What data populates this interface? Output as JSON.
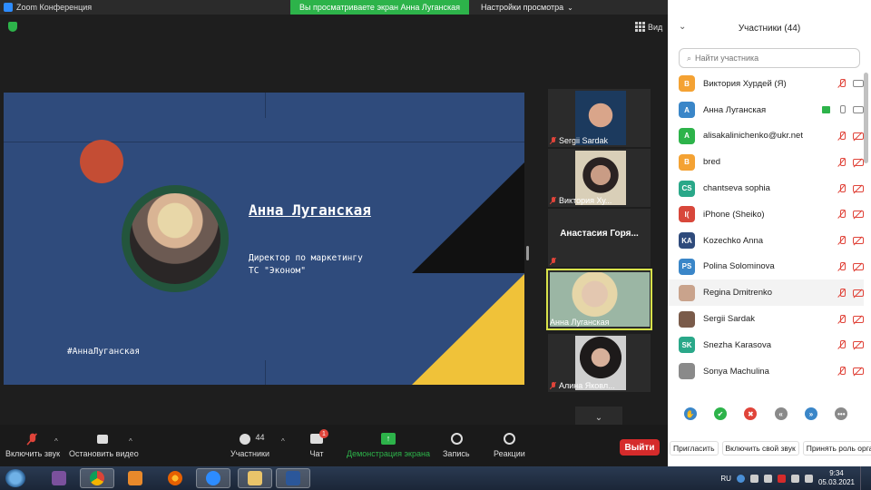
{
  "window": {
    "title": "Zoom Конференция"
  },
  "share_banner": "Вы просматриваете экран Анна Луганская",
  "view_settings": "Настройки просмотра",
  "view_button": "Вид",
  "slide": {
    "name": "Анна Луганская",
    "role_line1": "Директор по маркетингу",
    "role_line2": "ТС \"Эконом\"",
    "hashtag": "#АннаЛуганская"
  },
  "thumbnails": [
    {
      "label": "Sergii Sardak"
    },
    {
      "label": "Виктория  Ху..."
    },
    {
      "label": "Анастасия Горя...",
      "center": true
    },
    {
      "label": "Анна Луганская",
      "active": true
    },
    {
      "label": "Алина Яковл..."
    }
  ],
  "toolbar": {
    "unmute": "Включить звук",
    "start_video": "Остановить видео",
    "participants": "Участники",
    "participants_count": "44",
    "chat": "Чат",
    "chat_badge": "1",
    "share": "Демонстрация экрана",
    "record": "Запись",
    "reactions": "Реакции",
    "leave": "Выйти"
  },
  "panel": {
    "title": "Участники (44)",
    "search_placeholder": "Найти участника",
    "participants": [
      {
        "initials": "В",
        "name": "Виктория  Хурдей (Я)",
        "color": "#f4a233",
        "share": false,
        "mic": "off",
        "cam": "on"
      },
      {
        "initials": "А",
        "name": "Анна Луганская",
        "color": "#3a86c8",
        "share": true,
        "mic": "on",
        "cam": "on"
      },
      {
        "initials": "A",
        "name": "alisakalinichenko@ukr.net",
        "color": "#2db34a",
        "share": false,
        "mic": "off",
        "cam": "off"
      },
      {
        "initials": "B",
        "name": "bred",
        "color": "#f4a233",
        "share": false,
        "mic": "off",
        "cam": "off"
      },
      {
        "initials": "CS",
        "name": "chantseva sophia",
        "color": "#2aa889",
        "share": false,
        "mic": "off",
        "cam": "off"
      },
      {
        "initials": "I(",
        "name": "iPhone (Sheiko)",
        "color": "#d8473b",
        "share": false,
        "mic": "off",
        "cam": "off"
      },
      {
        "initials": "KA",
        "name": "Kozechko Anna",
        "color": "#2f4b7c",
        "share": false,
        "mic": "off",
        "cam": "off"
      },
      {
        "initials": "PS",
        "name": "Polina Solominova",
        "color": "#3a86c8",
        "share": false,
        "mic": "off",
        "cam": "off"
      },
      {
        "initials": "",
        "name": "Regina Dmitrenko",
        "color": "#c9a38c",
        "share": false,
        "mic": "off",
        "cam": "off",
        "hover": true
      },
      {
        "initials": "",
        "name": "Sergii Sardak",
        "color": "#7a5b4a",
        "share": false,
        "mic": "off",
        "cam": "off"
      },
      {
        "initials": "SK",
        "name": "Snezha Karasova",
        "color": "#2aa889",
        "share": false,
        "mic": "off",
        "cam": "off"
      },
      {
        "initials": "",
        "name": "Sonya Machulina",
        "color": "#8a8a8a",
        "share": false,
        "mic": "off",
        "cam": "off"
      }
    ],
    "reactions": [
      {
        "name": "raise-hand",
        "color": "#3a86c8",
        "glyph": "✋"
      },
      {
        "name": "yes",
        "color": "#2db34a",
        "glyph": "✔"
      },
      {
        "name": "no",
        "color": "#e0443a",
        "glyph": "✖"
      },
      {
        "name": "slower",
        "color": "#8a8a8a",
        "glyph": "«"
      },
      {
        "name": "faster",
        "color": "#3a86c8",
        "glyph": "»"
      },
      {
        "name": "more",
        "color": "#8a8a8a",
        "glyph": "•••"
      }
    ],
    "footer": {
      "invite": "Пригласить",
      "unmute_me": "Включить свой звук",
      "take_host": "Принять роль орга"
    }
  },
  "taskbar": {
    "lang": "RU",
    "time": "9:34",
    "date": "05.03.2021"
  },
  "colors": {
    "zoom_blue": "#2d8cff",
    "share_green": "#2db34a",
    "leave_red": "#d52b2b",
    "slide_blue": "#2f4b7c",
    "slide_yellow": "#f0c239"
  }
}
